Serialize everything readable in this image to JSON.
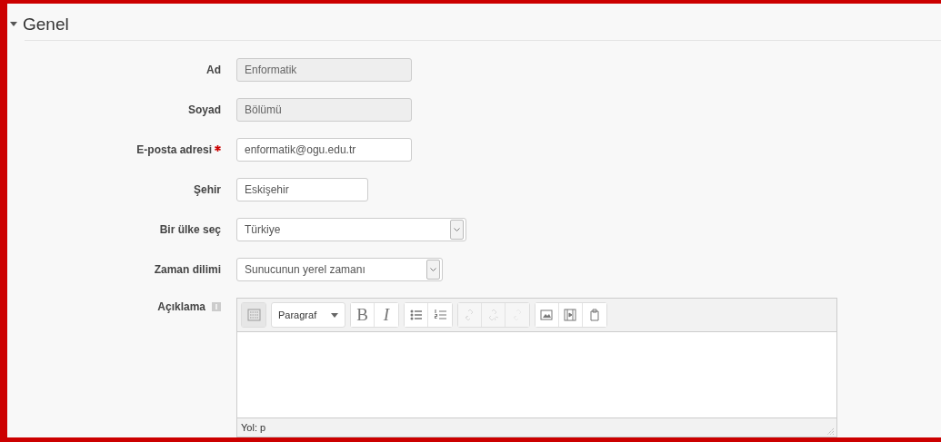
{
  "section": {
    "title": "Genel",
    "expanded": true
  },
  "fields": [
    {
      "kind": "text",
      "label": "Ad",
      "value": "Enformatik",
      "disabled": true,
      "required": false
    },
    {
      "kind": "text",
      "label": "Soyad",
      "value": "Bölümü",
      "disabled": true,
      "required": false
    },
    {
      "kind": "text",
      "label": "E-posta adresi",
      "value": "enformatik@ogu.edu.tr",
      "disabled": false,
      "required": true
    },
    {
      "kind": "text",
      "label": "Şehir",
      "value": "Eskişehir",
      "disabled": false,
      "required": false
    },
    {
      "kind": "select",
      "label": "Bir ülke seç",
      "value": "Türkiye",
      "disabled": false,
      "required": false
    },
    {
      "kind": "select",
      "label": "Zaman dilimi",
      "value": "Sunucunun yerel zamanı",
      "disabled": false,
      "required": false
    }
  ],
  "editor": {
    "label": "Açıklama",
    "help": true,
    "format": "Paragraf",
    "path": "Yol: p",
    "groups": [
      [
        {
          "kind": "toggle",
          "disabled": false
        }
      ],
      [
        {
          "kind": "format"
        }
      ],
      [
        {
          "kind": "bold",
          "text": "B",
          "disabled": false
        },
        {
          "kind": "italic",
          "text": "I",
          "disabled": false
        }
      ],
      [
        {
          "kind": "bullets",
          "disabled": false
        },
        {
          "kind": "numbers",
          "disabled": false
        }
      ],
      [
        {
          "kind": "link",
          "disabled": true
        },
        {
          "kind": "unlink",
          "disabled": true
        },
        {
          "kind": "anchor",
          "disabled": true
        }
      ],
      [
        {
          "kind": "image",
          "disabled": false
        },
        {
          "kind": "media",
          "disabled": false
        },
        {
          "kind": "paste",
          "disabled": false
        }
      ]
    ]
  }
}
